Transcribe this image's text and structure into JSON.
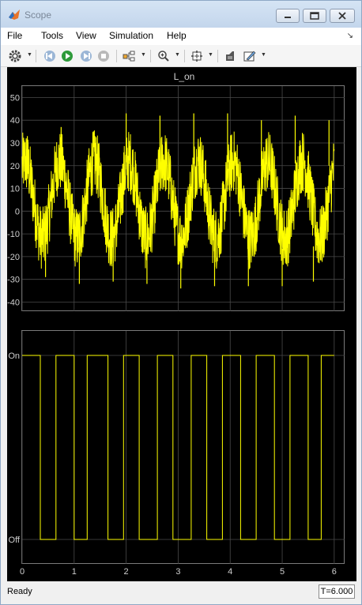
{
  "window": {
    "title": "Scope"
  },
  "menu": {
    "items": [
      "File",
      "Tools",
      "View",
      "Simulation",
      "Help"
    ]
  },
  "toolbar": {
    "buttons": [
      "settings-icon",
      "step-back-icon",
      "run-icon",
      "step-forward-icon",
      "stop-icon",
      "highlight-block-icon",
      "zoom-in-icon",
      "autoscale-icon",
      "restore-layout-icon",
      "style-icon"
    ]
  },
  "chart_data": [
    {
      "type": "line",
      "title": "L_on",
      "xlim": [
        0,
        6.2
      ],
      "ylim": [
        -44,
        55
      ],
      "yticks": [
        -40,
        -30,
        -20,
        -10,
        0,
        10,
        20,
        30,
        40,
        50
      ],
      "ytick_labels": [
        "-40",
        "-30",
        "-20",
        "-10",
        "0",
        "10",
        "20",
        "30",
        "40",
        "50"
      ],
      "grid": true,
      "series": [
        {
          "color": "#ffff00",
          "x_start": 0,
          "x_end": 6,
          "period": 0.667,
          "sine_amplitude": 17,
          "noise_amplitude": 14,
          "peaks": [
            [
              0.1,
              33
            ],
            [
              0.75,
              37
            ],
            [
              1.4,
              33
            ],
            [
              2.0,
              43
            ],
            [
              2.65,
              42
            ],
            [
              3.3,
              43
            ],
            [
              3.95,
              43
            ],
            [
              4.6,
              40
            ],
            [
              5.25,
              42
            ],
            [
              5.9,
              40
            ]
          ],
          "troughs": [
            [
              0.45,
              -29
            ],
            [
              1.1,
              -32
            ],
            [
              1.75,
              -31
            ],
            [
              2.4,
              -32
            ],
            [
              3.05,
              -34
            ],
            [
              3.7,
              -33
            ],
            [
              4.35,
              -33
            ],
            [
              5.0,
              -33
            ],
            [
              5.6,
              -31
            ]
          ]
        }
      ]
    },
    {
      "type": "line",
      "title": "",
      "xlim": [
        0,
        6.2
      ],
      "x_ticks": [
        0,
        1,
        2,
        3,
        4,
        5,
        6
      ],
      "x_tick_labels": [
        "0",
        "1",
        "2",
        "3",
        "4",
        "5",
        "6"
      ],
      "ylevels": [
        "Off",
        "On"
      ],
      "grid": true,
      "series": [
        {
          "color": "#ffff00",
          "step": true,
          "x": [
            0,
            0.35,
            0.35,
            0.65,
            0.65,
            1.0,
            1.0,
            1.25,
            1.25,
            1.65,
            1.65,
            1.95,
            1.95,
            2.25,
            2.25,
            2.6,
            2.6,
            2.9,
            2.9,
            3.25,
            3.25,
            3.55,
            3.55,
            3.85,
            3.85,
            4.2,
            4.2,
            4.5,
            4.5,
            4.85,
            4.85,
            5.15,
            5.15,
            5.5,
            5.5,
            5.75,
            5.75,
            6.0
          ],
          "y": [
            1,
            1,
            0,
            0,
            1,
            1,
            0,
            0,
            1,
            1,
            0,
            0,
            1,
            1,
            0,
            0,
            1,
            1,
            0,
            0,
            1,
            1,
            0,
            0,
            1,
            1,
            0,
            0,
            1,
            1,
            0,
            0,
            1,
            1,
            0,
            0,
            1,
            1
          ]
        }
      ]
    }
  ],
  "status": {
    "text": "Ready",
    "time": "T=6.000"
  }
}
